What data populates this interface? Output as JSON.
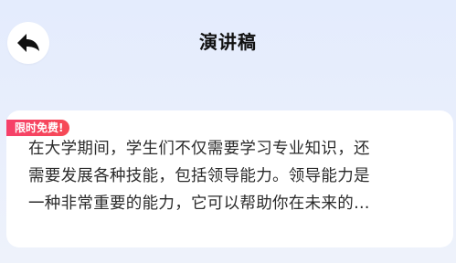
{
  "header": {
    "title": "演讲稿",
    "back_icon": "back-arrow-icon"
  },
  "card": {
    "badge": "限时免费!",
    "content_lines": [
      "在大学期间，学生们不仅需要学习专业知识，还",
      "需要发展各种技能，包括领导能力。领导能力是",
      "一种非常重要的能力，它可以帮助你在未来的…"
    ]
  },
  "colors": {
    "background": "#e6edfc",
    "badge": "#f6445f",
    "card": "#ffffff",
    "title": "#111111"
  }
}
